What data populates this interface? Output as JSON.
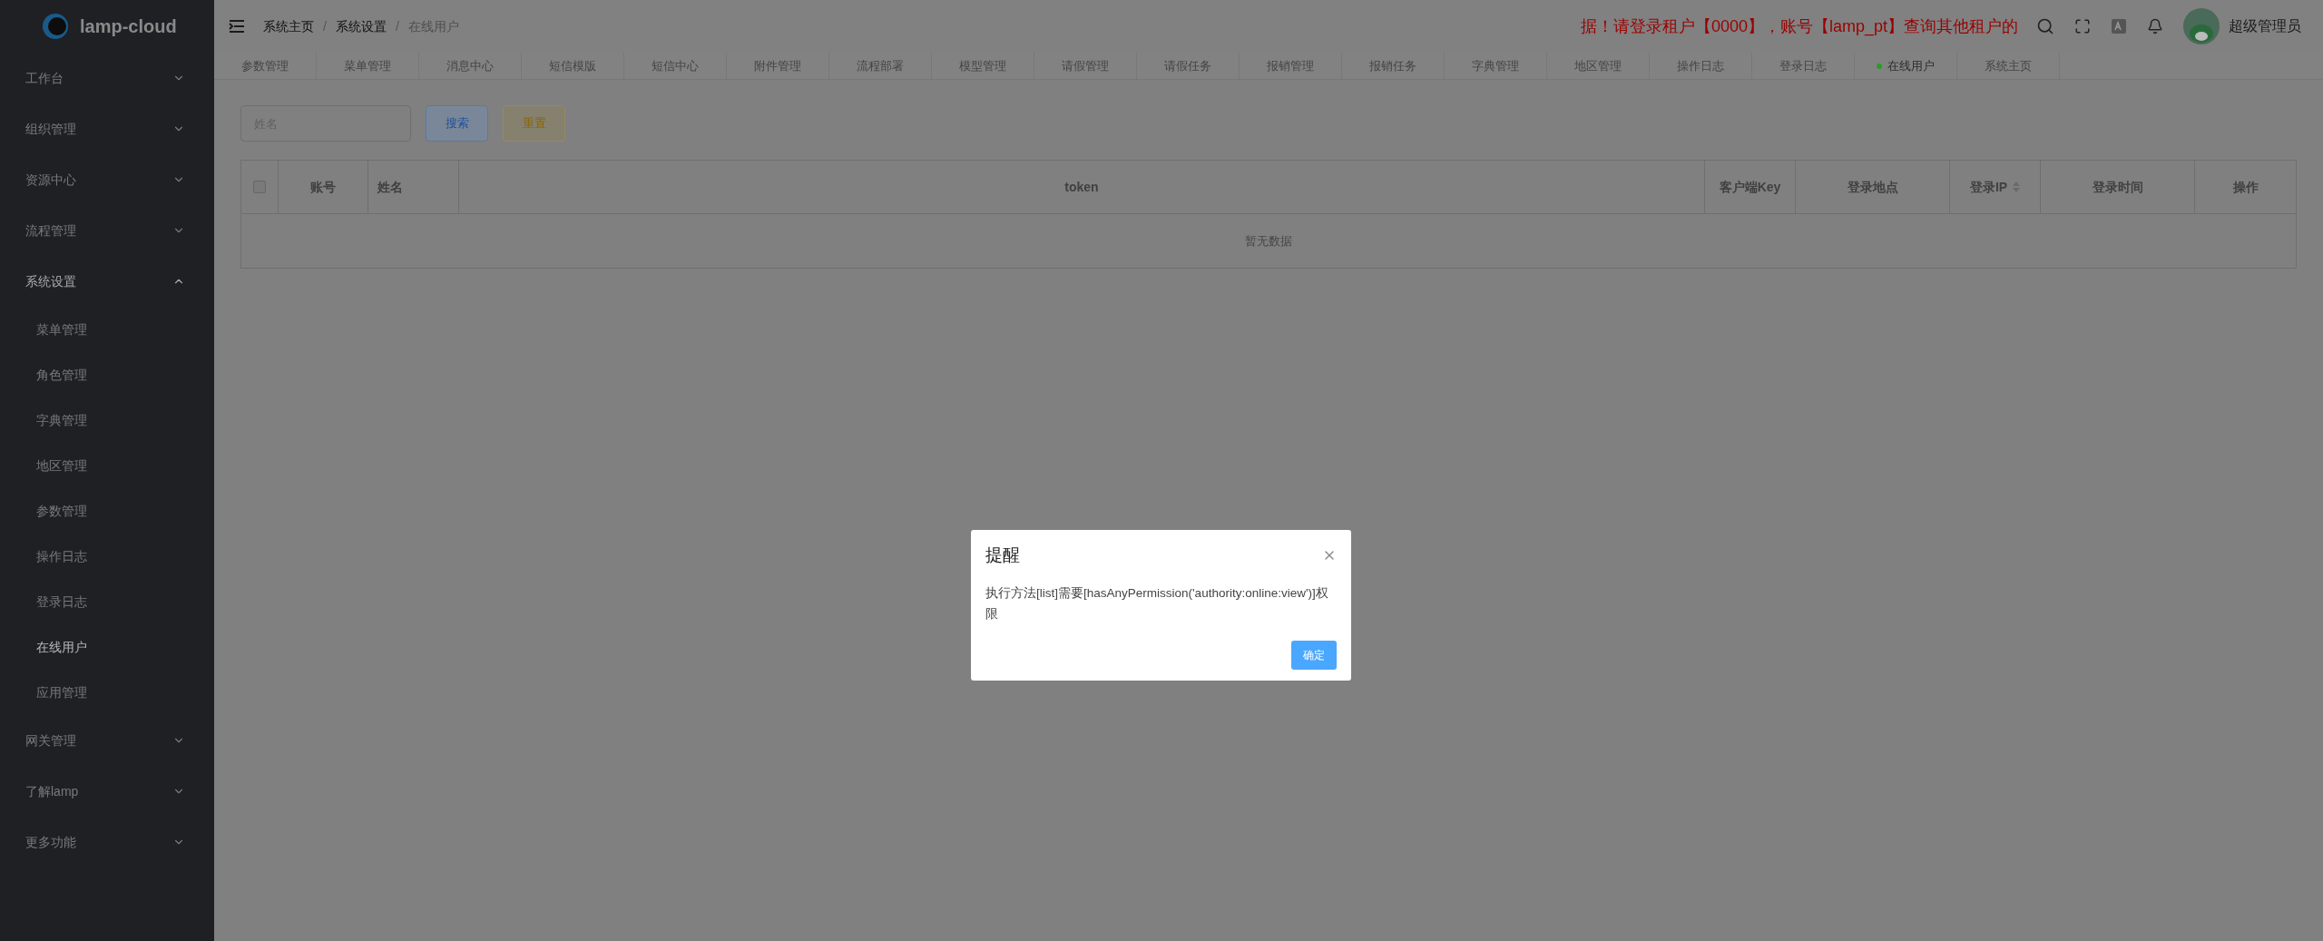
{
  "logo": {
    "text": "lamp-cloud"
  },
  "breadcrumb_separator": "/",
  "breadcrumb": [
    {
      "label": "系统主页",
      "current": false
    },
    {
      "label": "系统设置",
      "current": false
    },
    {
      "label": "在线用户",
      "current": true
    }
  ],
  "notice": "据！请登录租户【0000】，账号【lamp_pt】查询其他租户的",
  "user": {
    "name": "超级管理员"
  },
  "tabs": [
    {
      "label": "参数管理",
      "selected": false
    },
    {
      "label": "菜单管理",
      "selected": false
    },
    {
      "label": "消息中心",
      "selected": false
    },
    {
      "label": "短信模版",
      "selected": false
    },
    {
      "label": "短信中心",
      "selected": false
    },
    {
      "label": "附件管理",
      "selected": false
    },
    {
      "label": "流程部署",
      "selected": false
    },
    {
      "label": "模型管理",
      "selected": false
    },
    {
      "label": "请假管理",
      "selected": false
    },
    {
      "label": "请假任务",
      "selected": false
    },
    {
      "label": "报销管理",
      "selected": false
    },
    {
      "label": "报销任务",
      "selected": false
    },
    {
      "label": "字典管理",
      "selected": false
    },
    {
      "label": "地区管理",
      "selected": false
    },
    {
      "label": "操作日志",
      "selected": false
    },
    {
      "label": "登录日志",
      "selected": false
    },
    {
      "label": "在线用户",
      "selected": true
    },
    {
      "label": "系统主页",
      "selected": false
    }
  ],
  "sidebar": {
    "items": [
      {
        "label": "工作台",
        "expanded": false
      },
      {
        "label": "组织管理",
        "expanded": false
      },
      {
        "label": "资源中心",
        "expanded": false
      },
      {
        "label": "流程管理",
        "expanded": false
      },
      {
        "label": "系统设置",
        "expanded": true,
        "children": [
          {
            "label": "菜单管理",
            "selected": false
          },
          {
            "label": "角色管理",
            "selected": false
          },
          {
            "label": "字典管理",
            "selected": false
          },
          {
            "label": "地区管理",
            "selected": false
          },
          {
            "label": "参数管理",
            "selected": false
          },
          {
            "label": "操作日志",
            "selected": false
          },
          {
            "label": "登录日志",
            "selected": false
          },
          {
            "label": "在线用户",
            "selected": true
          },
          {
            "label": "应用管理",
            "selected": false
          }
        ]
      },
      {
        "label": "网关管理",
        "expanded": false
      },
      {
        "label": "了解lamp",
        "expanded": false
      },
      {
        "label": "更多功能",
        "expanded": false
      }
    ]
  },
  "search": {
    "placeholder": "姓名"
  },
  "buttons": [
    {
      "label": "搜索",
      "kind": "primary"
    },
    {
      "label": "重置",
      "kind": "warning"
    }
  ],
  "table": {
    "select_all": {
      "checked": false
    },
    "columns": [
      {
        "label": "账号",
        "sortable": false
      },
      {
        "label": "姓名",
        "sortable": false
      },
      {
        "label": "token",
        "sortable": false
      },
      {
        "label": "客户端Key",
        "sortable": false
      },
      {
        "label": "登录地点",
        "sortable": false
      },
      {
        "label": "登录IP",
        "sortable": true
      },
      {
        "label": "登录时间",
        "sortable": false
      },
      {
        "label": "操作",
        "sortable": false
      }
    ],
    "empty_text": "暂无数据"
  },
  "dialog": {
    "title": "提醒",
    "message": "执行方法[list]需要[hasAnyPermission('authority:online:view')]权限",
    "button": "确定"
  }
}
